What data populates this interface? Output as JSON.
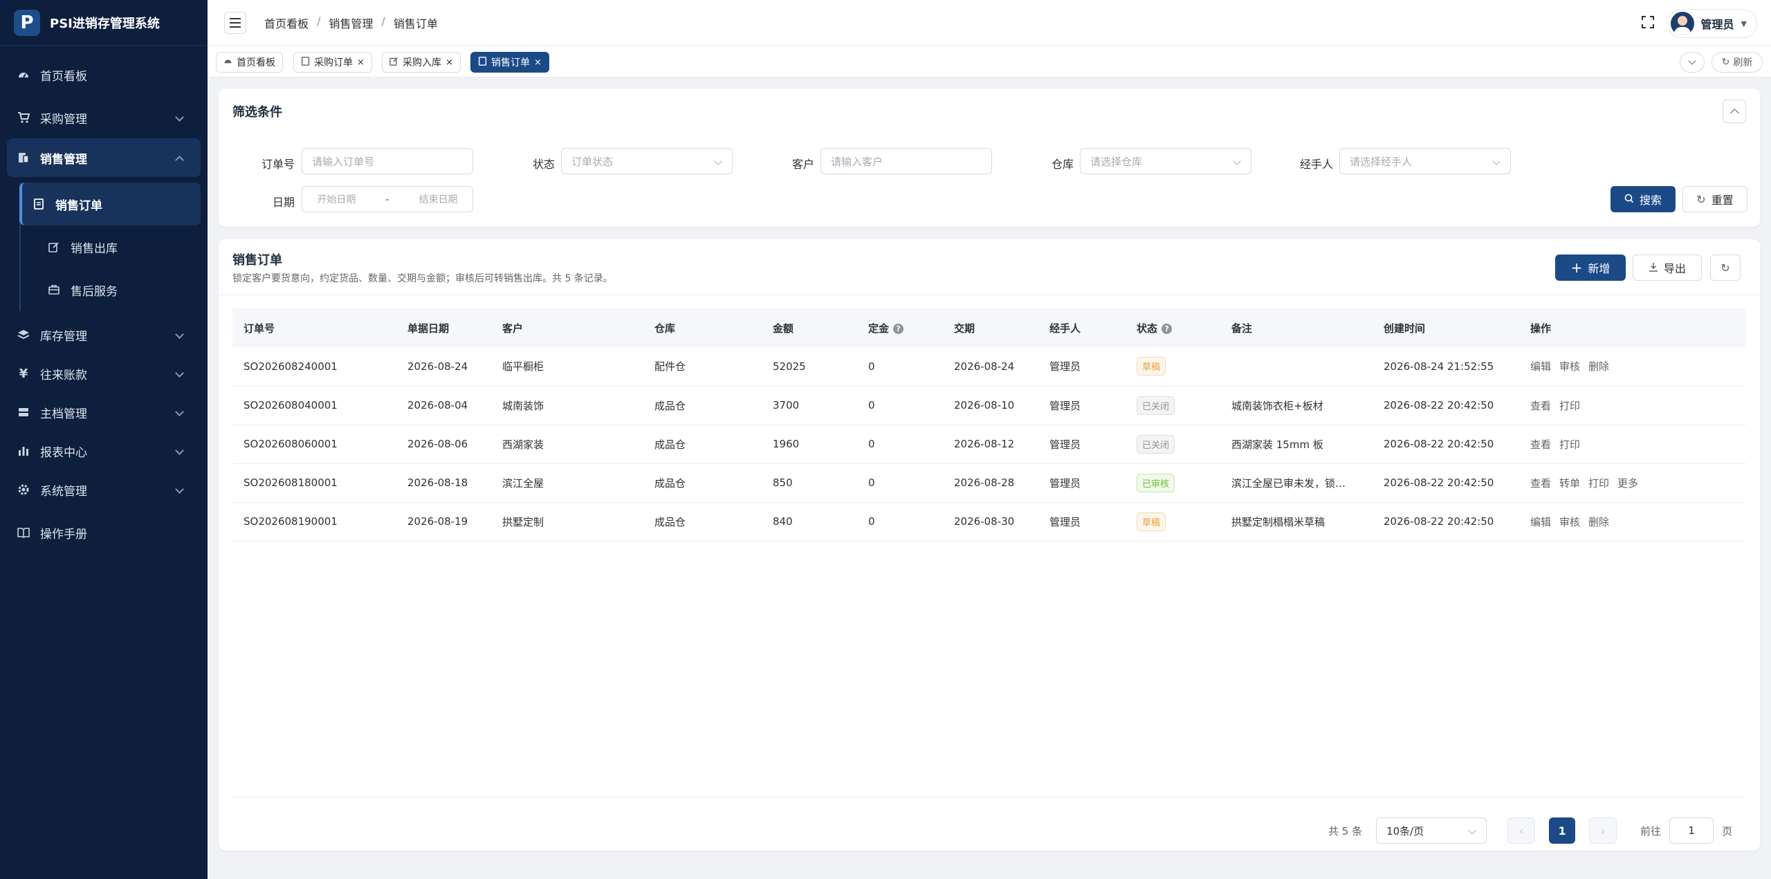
{
  "app": {
    "logo_letter": "P",
    "title": "PSI进销存管理系统"
  },
  "sidebar": {
    "items": [
      {
        "label": "首页看板",
        "icon": "dashboard-icon"
      },
      {
        "label": "采购管理",
        "icon": "cart-icon"
      },
      {
        "label": "销售管理",
        "icon": "sales-icon"
      },
      {
        "label": "销售订单",
        "icon": "document-icon"
      },
      {
        "label": "销售出库",
        "icon": "edit-icon"
      },
      {
        "label": "售后服务",
        "icon": "briefcase-icon"
      },
      {
        "label": "库存管理",
        "icon": "stack-icon"
      },
      {
        "label": "往来账款",
        "icon": "yen-icon"
      },
      {
        "label": "主档管理",
        "icon": "database-icon"
      },
      {
        "label": "报表中心",
        "icon": "bar-chart-icon"
      },
      {
        "label": "系统管理",
        "icon": "gear-icon"
      },
      {
        "label": "操作手册",
        "icon": "book-icon"
      }
    ]
  },
  "header": {
    "breadcrumb": [
      "首页看板",
      "销售管理",
      "销售订单"
    ],
    "breadcrumb_sep": "/",
    "user": "管理员"
  },
  "tabs": {
    "items": [
      "首页看板",
      "采购订单",
      "采购入库",
      "销售订单"
    ],
    "close": "×",
    "refresh": "刷新"
  },
  "filter": {
    "title": "筛选条件",
    "order_no_label": "订单号",
    "order_no_placeholder": "请输入订单号",
    "status_label": "状态",
    "status_placeholder": "订单状态",
    "customer_label": "客户",
    "customer_placeholder": "请输入客户",
    "warehouse_label": "仓库",
    "warehouse_placeholder": "请选择仓库",
    "handler_label": "经手人",
    "handler_placeholder": "请选择经手人",
    "date_label": "日期",
    "date_start": "开始日期",
    "date_sep": "-",
    "date_end": "结束日期",
    "search": "搜索",
    "reset": "重置"
  },
  "table": {
    "title": "销售订单",
    "desc": "锁定客户要货意向，约定货品、数量、交期与金额；审核后可转销售出库。共 5 条记录。",
    "add": "新增",
    "export": "导出",
    "columns": [
      "订单号",
      "单据日期",
      "客户",
      "仓库",
      "金额",
      "定金",
      "交期",
      "经手人",
      "状态",
      "备注",
      "创建时间",
      "操作"
    ],
    "help_mark": "?",
    "rows": [
      {
        "no": "SO202608240001",
        "date": "2026-08-24",
        "customer": "临平橱柜",
        "warehouse": "配件仓",
        "amount": "52025",
        "deposit": "0",
        "due": "2026-08-24",
        "handler": "管理员",
        "status": "草稿",
        "status_class": "st-draft",
        "remark": "",
        "created": "2026-08-24 21:52:55",
        "ops": [
          "编辑",
          "审核",
          "删除"
        ]
      },
      {
        "no": "SO202608040001",
        "date": "2026-08-04",
        "customer": "城南装饰",
        "warehouse": "成品仓",
        "amount": "3700",
        "deposit": "0",
        "due": "2026-08-10",
        "handler": "管理员",
        "status": "已关闭",
        "status_class": "st-closed",
        "remark": "城南装饰衣柜+板材",
        "created": "2026-08-22 20:42:50",
        "ops": [
          "查看",
          "打印"
        ]
      },
      {
        "no": "SO202608060001",
        "date": "2026-08-06",
        "customer": "西湖家装",
        "warehouse": "成品仓",
        "amount": "1960",
        "deposit": "0",
        "due": "2026-08-12",
        "handler": "管理员",
        "status": "已关闭",
        "status_class": "st-closed",
        "remark": "西湖家装 15mm 板",
        "created": "2026-08-22 20:42:50",
        "ops": [
          "查看",
          "打印"
        ]
      },
      {
        "no": "SO202608180001",
        "date": "2026-08-18",
        "customer": "滨江全屋",
        "warehouse": "成品仓",
        "amount": "850",
        "deposit": "0",
        "due": "2026-08-28",
        "handler": "管理员",
        "status": "已审核",
        "status_class": "st-approved",
        "remark": "滨江全屋已审未发，锁…",
        "created": "2026-08-22 20:42:50",
        "ops": [
          "查看",
          "转单",
          "打印",
          "更多"
        ]
      },
      {
        "no": "SO202608190001",
        "date": "2026-08-19",
        "customer": "拱墅定制",
        "warehouse": "成品仓",
        "amount": "840",
        "deposit": "0",
        "due": "2026-08-30",
        "handler": "管理员",
        "status": "草稿",
        "status_class": "st-draft",
        "remark": "拱墅定制榻榻米草稿",
        "created": "2026-08-22 20:42:50",
        "ops": [
          "编辑",
          "审核",
          "删除"
        ]
      }
    ]
  },
  "pagination": {
    "total": "共 5 条",
    "page_size": "10条/页",
    "current": "1",
    "goto_label": "前往",
    "goto_value": "1",
    "page_unit": "页"
  }
}
